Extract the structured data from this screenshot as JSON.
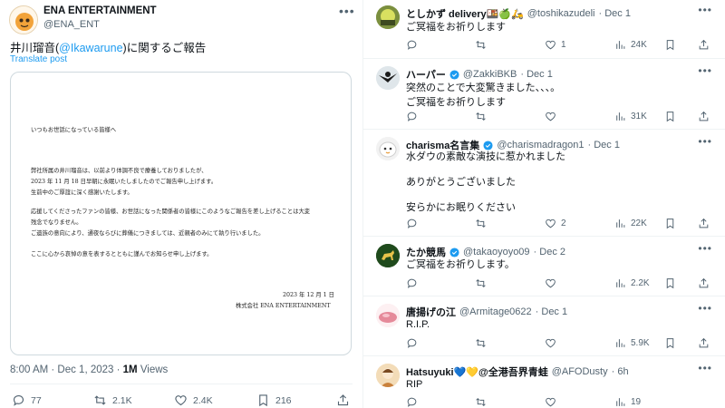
{
  "post": {
    "author_name": "ENA ENTERTAINMENT",
    "author_handle": "@ENA_ENT",
    "text_prefix": "井川瑠音(",
    "text_mention": "@Ikawarune",
    "text_suffix": ")に関するご報告",
    "translate_label": "Translate post",
    "letter": {
      "greeting": "いつもお世話になっている皆様へ",
      "p1_l1": "弊社所属の井川瑠音は、以前より体調不良で療養しておりましたが、",
      "p1_l2": "2023 年 11 月 18 日早朝に永眠いたしましたのでご報告申し上げます。",
      "p1_l3": "生前中のご厚誼に深く感謝いたします。",
      "p2_l1": "応援してくださったファンの皆様、お世話になった関係者の皆様にこのようなご報告を差し上げることは大変",
      "p2_l2": "残念でなりません。",
      "p2_l3": "ご遺族の意向により、通夜ならびに葬儀につきましては、近親者のみにて執り行いました。",
      "p3": "ここに心から哀悼の意を表するとともに謹んでお知らせ申し上げます。",
      "date": "2023 年 12 月 1 日",
      "signature": "株式会社 ENA ENTERTAINMENT"
    },
    "timestamp": "8:00 AM · Dec 1, 2023 · ",
    "views_count": "1M",
    "views_label": " Views",
    "stats": {
      "replies": "77",
      "reposts": "2.1K",
      "likes": "2.4K",
      "bookmarks": "216"
    }
  },
  "replies": [
    {
      "name": "としかず delivery🍱🍏🛵",
      "handle": "@toshikazudeli",
      "time": "· Dec 1",
      "verified": false,
      "lines": [
        "ご冥福をお祈りします"
      ],
      "replies": "",
      "reposts": "",
      "likes": "1",
      "views": "24K"
    },
    {
      "name": "ハーパー",
      "handle": "@ZakkiBKB",
      "time": "· Dec 1",
      "verified": true,
      "lines": [
        "突然のことで大変驚きました、、、。",
        "ご冥福をお祈りします"
      ],
      "replies": "",
      "reposts": "",
      "likes": "",
      "views": "31K"
    },
    {
      "name": "charisma名言集",
      "handle": "@charismadragon1",
      "time": "· Dec 1",
      "verified": true,
      "lines": [
        "水ダウの素敵な演技に惹かれました",
        "",
        "ありがとうございました",
        "",
        "安らかにお眠りください"
      ],
      "replies": "",
      "reposts": "",
      "likes": "2",
      "views": "22K"
    },
    {
      "name": "たか競馬",
      "handle": "@takaoyoyo09",
      "time": "· Dec 2",
      "verified": true,
      "lines": [
        "ご冥福をお祈りします。"
      ],
      "replies": "",
      "reposts": "",
      "likes": "",
      "views": "2.2K"
    },
    {
      "name": "唐揚げの江",
      "handle": "@Armitage0622",
      "time": "· Dec 1",
      "verified": false,
      "lines": [
        "R.I.P."
      ],
      "replies": "",
      "reposts": "",
      "likes": "",
      "views": "5.9K"
    },
    {
      "name": "Hatsuyuki💙💛@全港吾界青蛙",
      "handle": "@AFODusty",
      "time": "· 6h",
      "verified": false,
      "lines": [
        "RIP"
      ],
      "replies": "",
      "reposts": "",
      "likes": "",
      "views": "19"
    }
  ],
  "colors": {
    "accent": "#1d9bf0",
    "muted": "#536471",
    "text": "#0f1419",
    "border": "#eff3f4"
  }
}
